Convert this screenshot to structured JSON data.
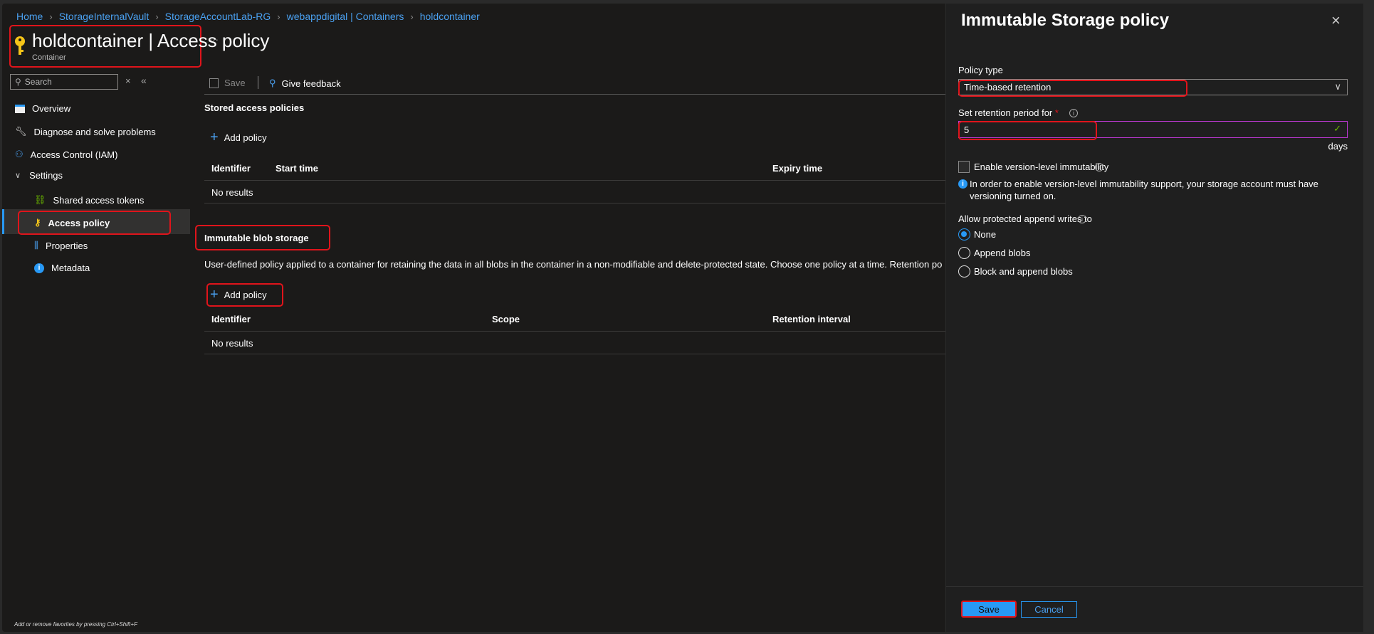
{
  "breadcrumb": [
    "Home",
    "StorageInternalVault",
    "StorageAccountLab-RG",
    "webappdigital | Containers",
    "holdcontainer"
  ],
  "header": {
    "title": "holdcontainer | Access policy",
    "subtitle": "Container",
    "more": "···"
  },
  "sidebar": {
    "search_placeholder": "Search",
    "items": [
      {
        "label": "Overview"
      },
      {
        "label": "Diagnose and solve problems"
      },
      {
        "label": "Access Control (IAM)"
      },
      {
        "label": "Settings"
      },
      {
        "label": "Shared access tokens"
      },
      {
        "label": "Access policy"
      },
      {
        "label": "Properties"
      },
      {
        "label": "Metadata"
      }
    ],
    "footer": "Add or remove favorites by pressing Ctrl+Shift+F"
  },
  "toolbar": {
    "save": "Save",
    "feedback": "Give feedback"
  },
  "stored": {
    "title": "Stored access policies",
    "add": "Add policy",
    "columns": [
      "Identifier",
      "Start time",
      "Expiry time"
    ],
    "empty": "No results"
  },
  "immutable": {
    "title": "Immutable blob storage",
    "description": "User-defined policy applied to a container for retaining the data in all blobs in the container in a non-modifiable and delete-protected state. Choose one policy at a time. Retention po",
    "add": "Add policy",
    "columns": [
      "Identifier",
      "Scope",
      "Retention interval"
    ],
    "empty": "No results"
  },
  "panel": {
    "title": "Immutable Storage policy",
    "policy_type_label": "Policy type",
    "policy_type_value": "Time-based retention",
    "retention_label": "Set retention period for",
    "required": "*",
    "retention_value": "5",
    "retention_unit": "days",
    "version_label": "Enable version-level immutability",
    "version_info": "In order to enable version-level immutability support, your storage account must have",
    "version_info2": "versioning turned on.",
    "append_label": "Allow protected append writes to",
    "options": [
      "None",
      "Append blobs",
      "Block and append blobs"
    ],
    "selected": "None",
    "save": "Save",
    "cancel": "Cancel"
  },
  "colors": {
    "accent": "#2899f5",
    "highlight": "#e0141b",
    "input_focus": "#c239d8"
  }
}
